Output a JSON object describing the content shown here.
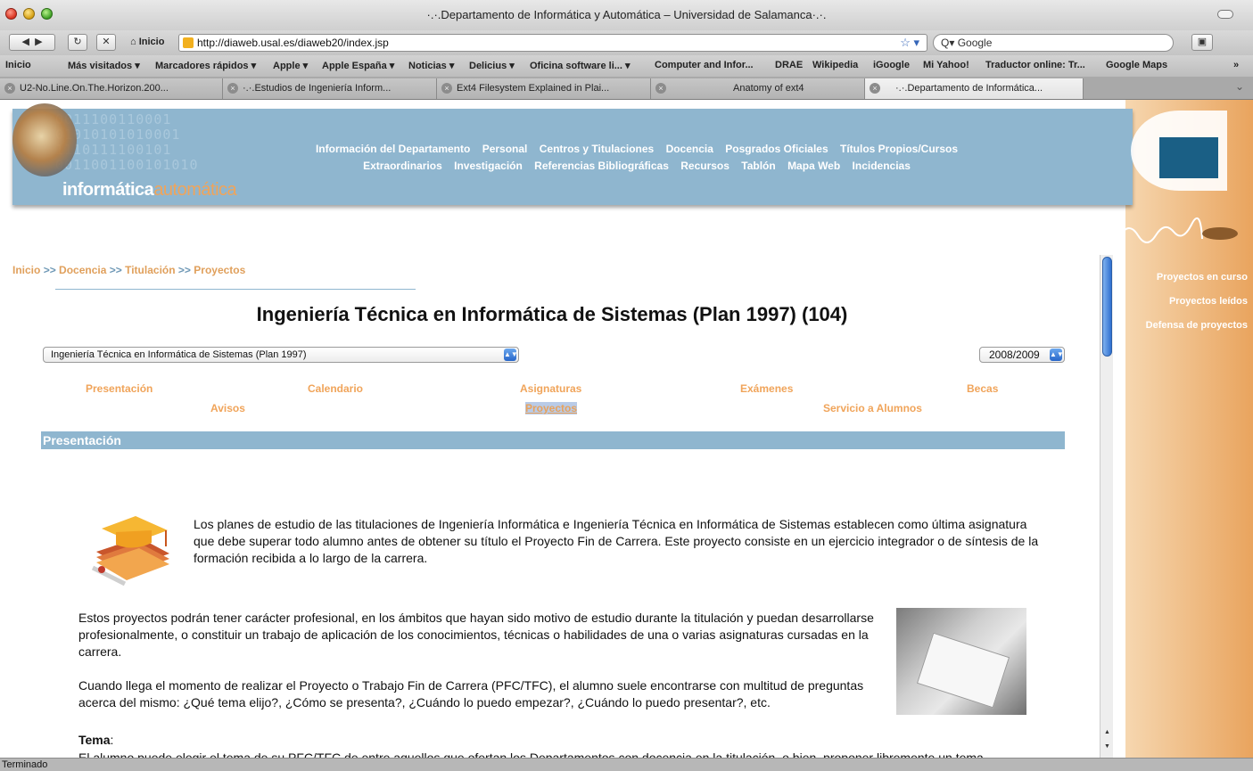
{
  "window": {
    "title": "·.·.Departamento de Informática y Automática – Universidad de Salamanca·.·."
  },
  "navbar": {
    "home_label": "Inicio",
    "url": "http://diaweb.usal.es/diaweb20/index.jsp",
    "search_placeholder": "Google"
  },
  "bookmarks": [
    "Inicio",
    "Más visitados ▾",
    "Marcadores rápidos ▾",
    "Apple ▾",
    "Apple España ▾",
    "Noticias ▾",
    "Delicius ▾",
    "Oficina software li... ▾",
    "Computer and Infor...",
    "DRAE",
    "Wikipedia",
    "iGoogle",
    "Mi Yahoo!",
    "Traductor online: Tr...",
    "Google Maps"
  ],
  "tabs": [
    "U2-No.Line.On.The.Horizon.200...",
    "·.·.Estudios de Ingeniería Inform...",
    "Ext4 Filesystem Explained in Plai...",
    "Anatomy of ext4",
    "·.·.Departamento de Informática..."
  ],
  "banner": {
    "binary": [
      "0011100110001",
      "01010101010001",
      "1110111100101",
      "0011001100101010"
    ],
    "logo_main": "informática",
    "logo_accent": "automática",
    "menu_line1": [
      "Información del Departamento",
      "Personal",
      "Centros y Titulaciones",
      "Docencia",
      "Posgrados Oficiales",
      "Títulos Propios/Cursos"
    ],
    "menu_line2": [
      "Extraordinarios",
      "Investigación",
      "Referencias Bibliográficas",
      "Recursos",
      "Tablón",
      "Mapa Web",
      "Incidencias"
    ]
  },
  "side_links": [
    "Proyectos en curso",
    "Proyectos leídos",
    "Defensa de proyectos"
  ],
  "breadcrumb": {
    "items": [
      "Inicio",
      "Docencia",
      "Titulación",
      "Proyectos"
    ],
    "sep": ">>"
  },
  "page_title": "Ingeniería Técnica en Informática de Sistemas (Plan 1997) (104)",
  "selects": {
    "plan": "Ingeniería Técnica en Informática de Sistemas (Plan 1997)",
    "year": "2008/2009"
  },
  "subnav": {
    "presentacion": "Presentación",
    "calendario": "Calendario",
    "asignaturas": "Asignaturas",
    "examenes": "Exámenes",
    "becas": "Becas",
    "avisos": "Avisos",
    "proyectos": "Proyectos",
    "servicio": "Servicio a Alumnos"
  },
  "section": {
    "title": "Presentación"
  },
  "content": {
    "p1": "Los planes de estudio de las titulaciones de Ingeniería Informática e Ingeniería Técnica en Informática de Sistemas establecen como última asignatura que debe superar todo alumno antes de obtener su título el Proyecto Fin de Carrera. Este proyecto consiste en un ejercicio integrador o de síntesis de la formación recibida a lo largo de la carrera.",
    "p2": "Estos proyectos podrán tener carácter profesional, en los ámbitos que hayan sido motivo de estudio durante la titulación y puedan desarrollarse profesionalmente, o constituir un trabajo de aplicación de los conocimientos, técnicas o habilidades de una o varias asignaturas cursadas en la carrera.",
    "p3": "Cuando llega el momento de realizar el Proyecto o Trabajo Fin de Carrera (PFC/TFC), el alumno suele encontrarse con multitud de preguntas acerca del mismo: ¿Qué tema elijo?, ¿Cómo se presenta?, ¿Cuándo lo puedo empezar?, ¿Cuándo lo puedo presentar?, etc.",
    "tema_label": "Tema",
    "tema_colon": ":",
    "p4": "El alumno puede elegir el tema de su PFC/TFC de entre aquellos que ofertan los Departamentos con docencia en la titulación, o bien, proponer libremente un tema"
  },
  "status": "Terminado"
}
